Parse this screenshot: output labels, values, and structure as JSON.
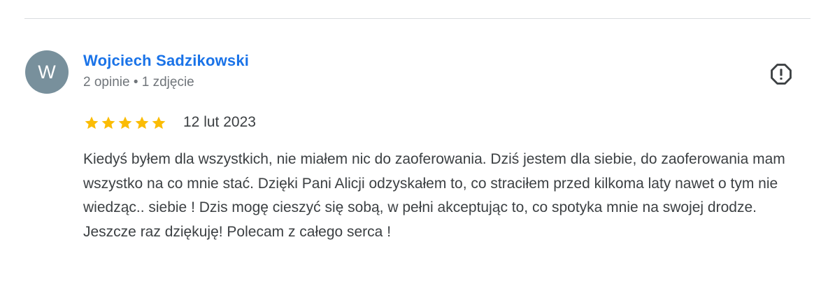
{
  "colors": {
    "accent": "#1a73e8",
    "avatar_bg": "#78909c",
    "star": "#fbbc04",
    "text": "#3c4043",
    "muted": "#70757a"
  },
  "review": {
    "avatar_initial": "W",
    "reviewer_name": "Wojciech Sadzikowski",
    "reviewer_meta": "2 opinie • 1 zdjęcie",
    "rating": 5,
    "rating_max": 5,
    "date": "12 lut 2023",
    "text": "Kiedyś byłem dla wszystkich, nie miałem nic do zaoferowania. Dziś jestem dla siebie, do zaoferowania mam wszystko na co mnie stać. Dzięki Pani Alicji odzyskałem to, co straciłem przed kilkoma laty nawet o tym nie wiedząc.. siebie ! Dzis mogę cieszyć się sobą, w pełni akceptując to, co spotyka mnie na swojej drodze. Jeszcze raz dziękuję! Polecam z całego serca !",
    "report_icon": "report-octagon-icon",
    "star_icon": "star-icon"
  }
}
